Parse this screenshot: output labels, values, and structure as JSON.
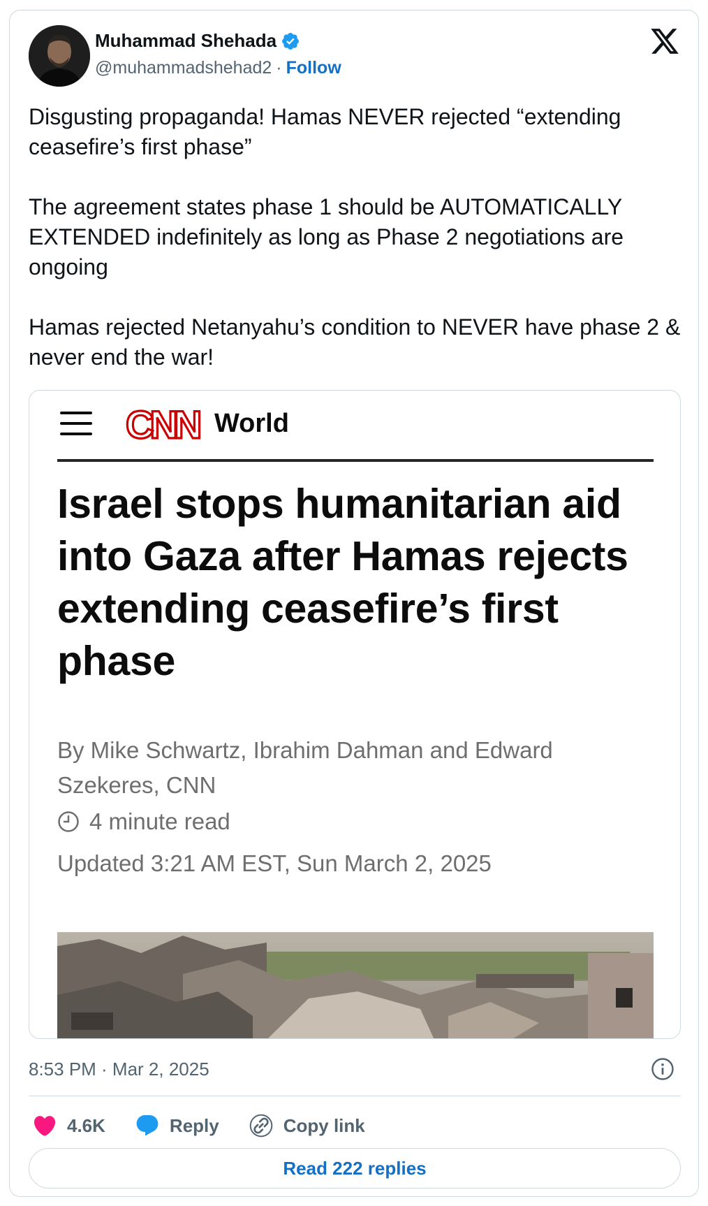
{
  "author": {
    "name": "Muhammad Shehada",
    "handle": "@muhammadshehad2",
    "separator": "·",
    "follow_label": "Follow",
    "verified_color": "#1d9bf0"
  },
  "tweet": {
    "paragraphs": [
      "Disgusting propaganda! Hamas NEVER rejected “extending ceasefire’s first phase”",
      "The agreement states phase 1 should be AUTOMATICALLY EXTENDED indefinitely as long as Phase 2 negotiations are ongoing",
      "Hamas rejected Netanyahu’s condition to NEVER have phase 2 & never end the war!"
    ],
    "timestamp": "8:53 PM · Mar 2, 2025"
  },
  "embed": {
    "logo_text": "CNN",
    "section": "World",
    "headline": "Israel stops humanitarian aid into Gaza after Hamas rejects extending ceasefire’s first phase",
    "byline": "By Mike Schwartz, Ibrahim Dahman and Edward Szekeres, CNN",
    "read_time": "4 minute read",
    "updated": "Updated 3:21 AM EST, Sun March 2, 2025",
    "brand_color": "#cc0000"
  },
  "actions": {
    "likes": "4.6K",
    "reply_label": "Reply",
    "copy_label": "Copy link",
    "read_replies_label": "Read 222 replies",
    "like_color": "#f91880",
    "reply_color": "#1d9bf0"
  },
  "icons": [
    "x-logo-icon",
    "verified-badge-icon",
    "hamburger-menu-icon",
    "clock-icon",
    "info-icon",
    "heart-icon",
    "reply-bubble-icon",
    "link-icon"
  ]
}
